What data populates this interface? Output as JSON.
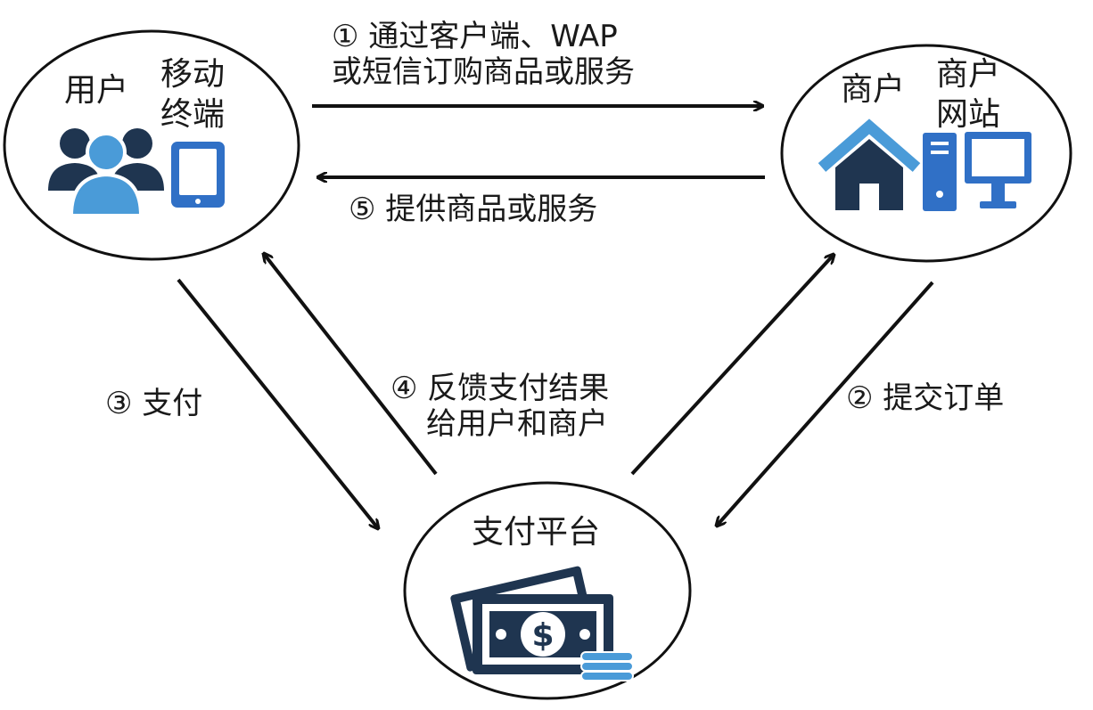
{
  "nodes": {
    "user": {
      "label": "用户",
      "device_label_1": "移动",
      "device_label_2": "终端",
      "icon": "users-icon",
      "device_icon": "tablet-icon"
    },
    "merchant": {
      "label": "商户",
      "site_label_1": "商户",
      "site_label_2": "网站",
      "icon": "house-icon",
      "site_icon": "computer-icon"
    },
    "payment": {
      "label": "支付平台",
      "icon": "cash-icon"
    }
  },
  "steps": {
    "s1_line1": "①  通过客户端、WAP",
    "s1_line2": "或短信订购商品或服务",
    "s2": "②  提交订单",
    "s3": "③  支付",
    "s4_line1": "④  反馈支付结果",
    "s4_line2": "给用户和商户",
    "s5": "⑤  提供商品或服务"
  },
  "colors": {
    "dark_navy": "#1f3550",
    "light_blue": "#4a9bd8",
    "medium_blue": "#3070c6",
    "line": "#111111"
  }
}
